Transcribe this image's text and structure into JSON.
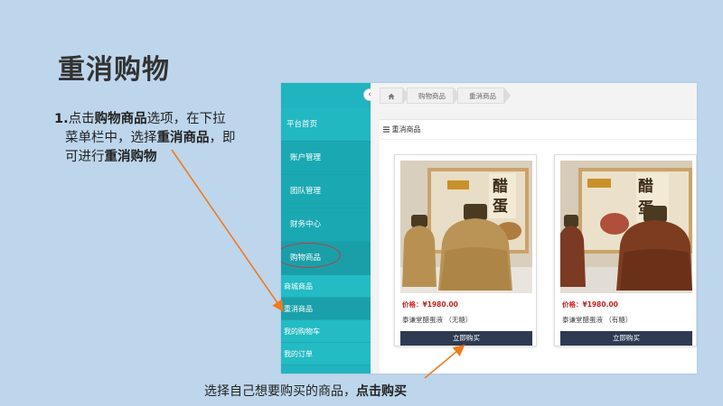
{
  "slide": {
    "title": "重消购物",
    "step": {
      "num": "1.",
      "t1": "点击",
      "b1": "购物商品",
      "t2": "选项，在下拉",
      "t3": "菜单栏中，选择",
      "b2": "重消商品",
      "t4": "，即",
      "t5": "可进行",
      "b3": "重消购物"
    },
    "bottom": {
      "text": "选择自己想要购买的商品，",
      "bold": "点击购买"
    }
  },
  "app": {
    "breadcrumb": [
      "购物商品",
      "重消商品"
    ],
    "sidebar": {
      "collapse_icon": "‹",
      "items": [
        "平台首页",
        "账户管理",
        "团队管理",
        "财务中心",
        "购物商品"
      ],
      "subitems": [
        "商城商品",
        "重消商品",
        "我的购物车",
        "我的订单"
      ]
    },
    "panel_title": "重消商品",
    "products": [
      {
        "price": "价格：¥1980.00",
        "name": "泰谦堂醋蛋液 （无糖）",
        "button": "立即购买"
      },
      {
        "price": "价格：¥1980.00",
        "name": "泰谦堂醋蛋液 （有糖）",
        "button": "立即购买"
      }
    ]
  },
  "colors": {
    "sidebar": "#1fb4bf",
    "buy_button": "#2d3a52",
    "price": "#c81e1e",
    "annotation_arrow": "#f07a1e",
    "circle": "#c43a3a"
  }
}
